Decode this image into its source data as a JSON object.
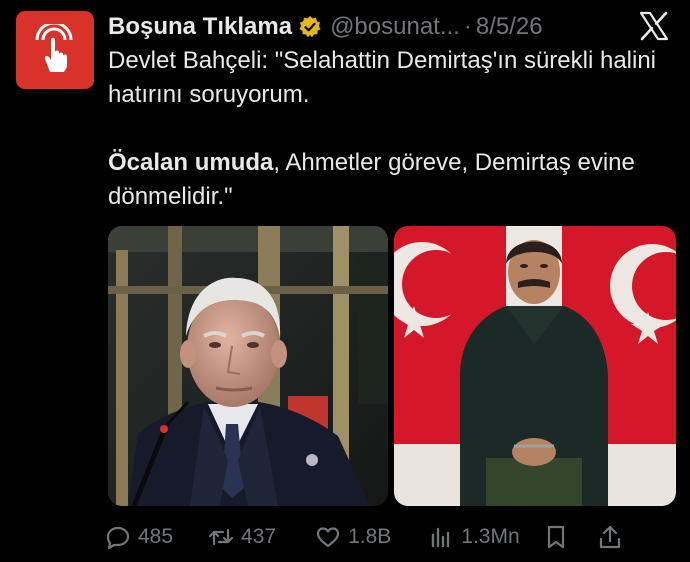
{
  "tweet": {
    "author_name": "Boşuna Tıklama",
    "handle": "@bosunat...",
    "separator": "·",
    "date": "8/5/26",
    "text_line1": "Devlet Bahçeli: \"Selahattin Demirtaş'ın sürekli halini hatırını soruyorum.",
    "text_bold": "Öcalan umuda",
    "text_rest": ", Ahmetler göreve, Demirtaş evine dönmelidir.\""
  },
  "metrics": {
    "replies": "485",
    "reposts": "437",
    "likes": "1.8B",
    "views": "1.3Mn"
  },
  "icons": [
    "hand-pointer-icon",
    "verified-badge-icon",
    "x-logo-icon",
    "reply-icon",
    "repost-icon",
    "like-icon",
    "views-icon",
    "bookmark-icon",
    "share-icon"
  ],
  "colors": {
    "background": "#000000",
    "text": "#e7e9ea",
    "muted": "#71767b",
    "avatar": "#d8322a",
    "badge": "#e2b719",
    "flag_red": "#d4182a"
  }
}
